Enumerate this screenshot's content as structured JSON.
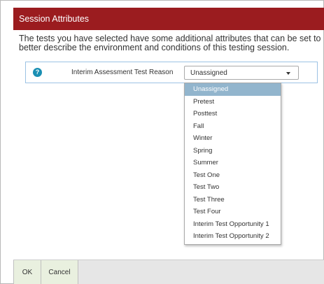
{
  "dialog": {
    "title": "Session Attributes",
    "description": "The tests you have selected have some additional attributes that can be set to better describe the environment and conditions of this testing session."
  },
  "attribute": {
    "help_icon": "question-circle-icon",
    "label": "Interim Assessment Test Reason",
    "selected_value": "Unassigned",
    "options": [
      "Unassigned",
      "Pretest",
      "Posttest",
      "Fall",
      "Winter",
      "Spring",
      "Summer",
      "Test One",
      "Test Two",
      "Test Three",
      "Test Four",
      "Interim Test Opportunity 1",
      "Interim Test Opportunity 2"
    ]
  },
  "footer": {
    "ok_label": "OK",
    "cancel_label": "Cancel"
  },
  "colors": {
    "title_bar": "#9b1c1f",
    "highlight": "#92b5cd",
    "help_icon": "#1a8fb3",
    "footer_button": "#e9f0df"
  }
}
